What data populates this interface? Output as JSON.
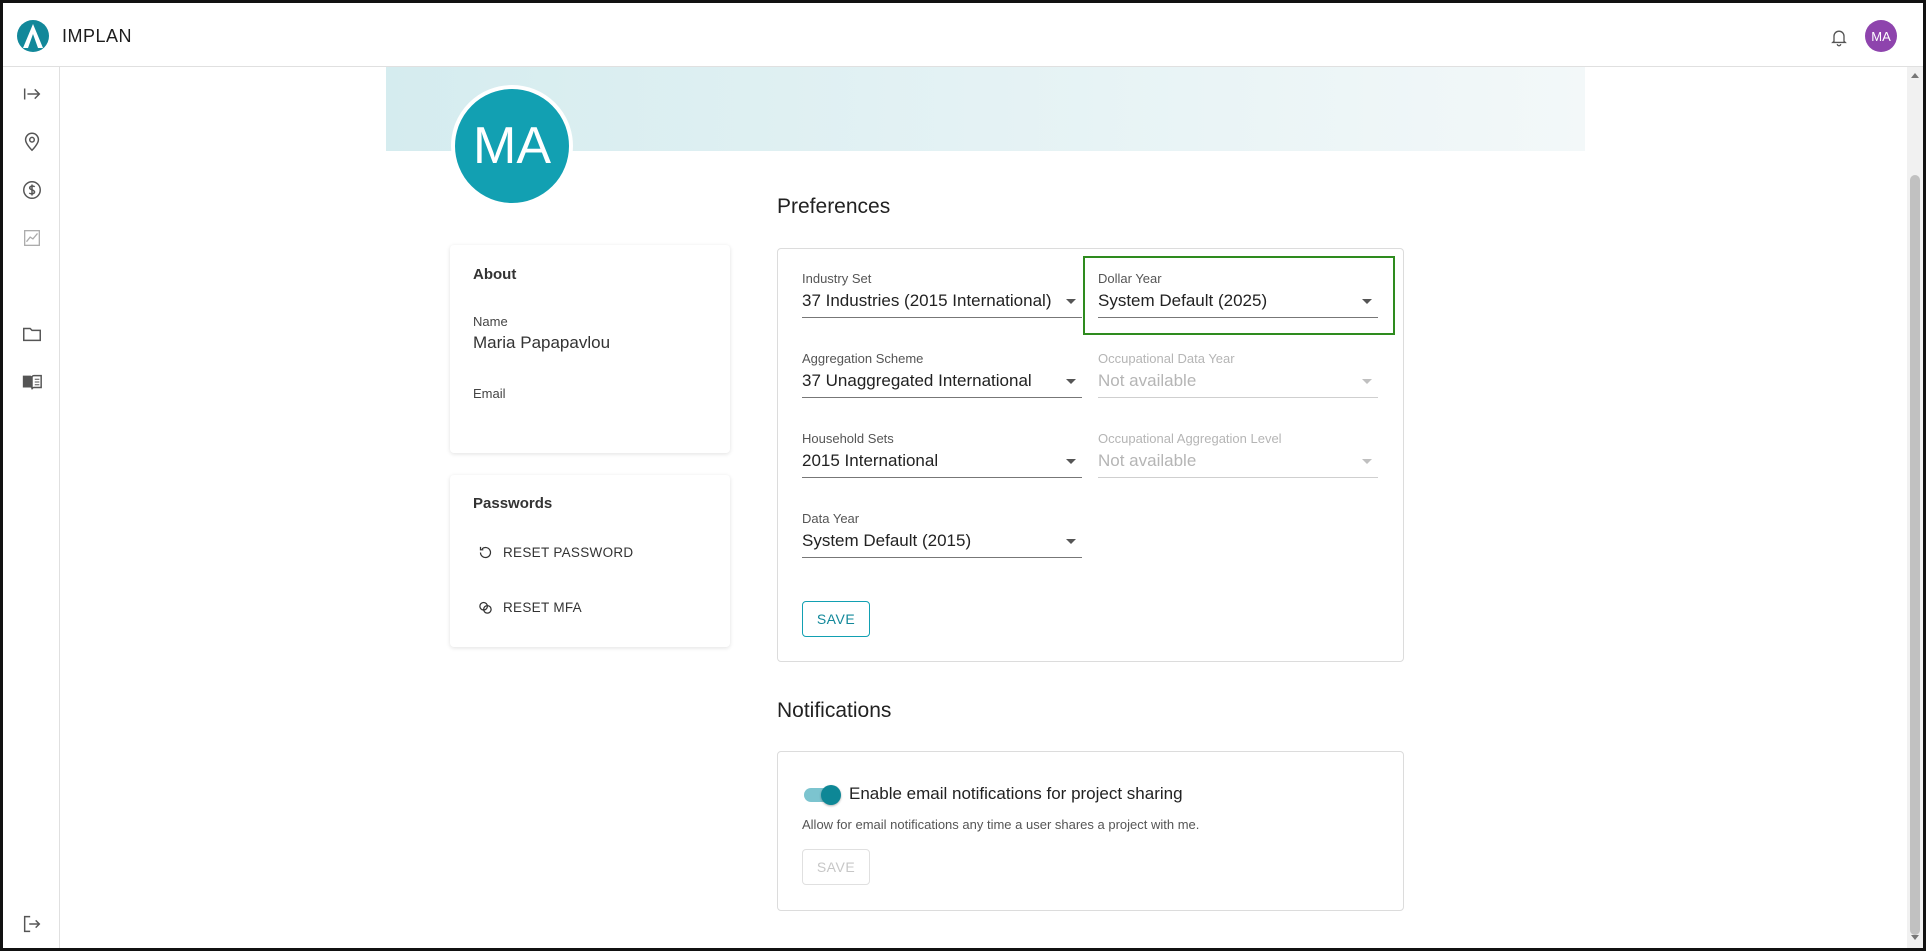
{
  "app": {
    "brand": "IMPLAN",
    "user_initials": "MA"
  },
  "sidebar": {
    "items": [
      {
        "name": "expand-icon"
      },
      {
        "name": "location-icon"
      },
      {
        "name": "dollar-icon"
      },
      {
        "name": "chart-icon"
      },
      {
        "name": "folder-icon"
      },
      {
        "name": "book-icon"
      },
      {
        "name": "logout-icon"
      }
    ]
  },
  "profile": {
    "initials": "MA",
    "about": {
      "title": "About",
      "name_label": "Name",
      "name_value": "Maria Papapavlou",
      "email_label": "Email",
      "email_value": ""
    },
    "passwords": {
      "title": "Passwords",
      "reset_password": "RESET PASSWORD",
      "reset_mfa": "RESET MFA"
    }
  },
  "preferences": {
    "title": "Preferences",
    "industry_set": {
      "label": "Industry Set",
      "value": "37 Industries (2015 International)"
    },
    "dollar_year": {
      "label": "Dollar Year",
      "value": "System Default (2025)"
    },
    "aggregation_scheme": {
      "label": "Aggregation Scheme",
      "value": "37 Unaggregated International"
    },
    "occupational_data_year": {
      "label": "Occupational Data Year",
      "value": "Not available"
    },
    "household_sets": {
      "label": "Household Sets",
      "value": "2015 International"
    },
    "occupational_aggregation_level": {
      "label": "Occupational Aggregation Level",
      "value": "Not available"
    },
    "data_year": {
      "label": "Data Year",
      "value": "System Default (2015)"
    },
    "save_label": "SAVE"
  },
  "notifications": {
    "title": "Notifications",
    "toggle_label": "Enable email notifications for project sharing",
    "toggle_on": true,
    "description": "Allow for email notifications any time a user shares a project with me.",
    "save_label": "SAVE"
  },
  "colors": {
    "accent": "#12a0b2",
    "highlight": "#2e8b1e",
    "avatar_top": "#8e44ad"
  }
}
